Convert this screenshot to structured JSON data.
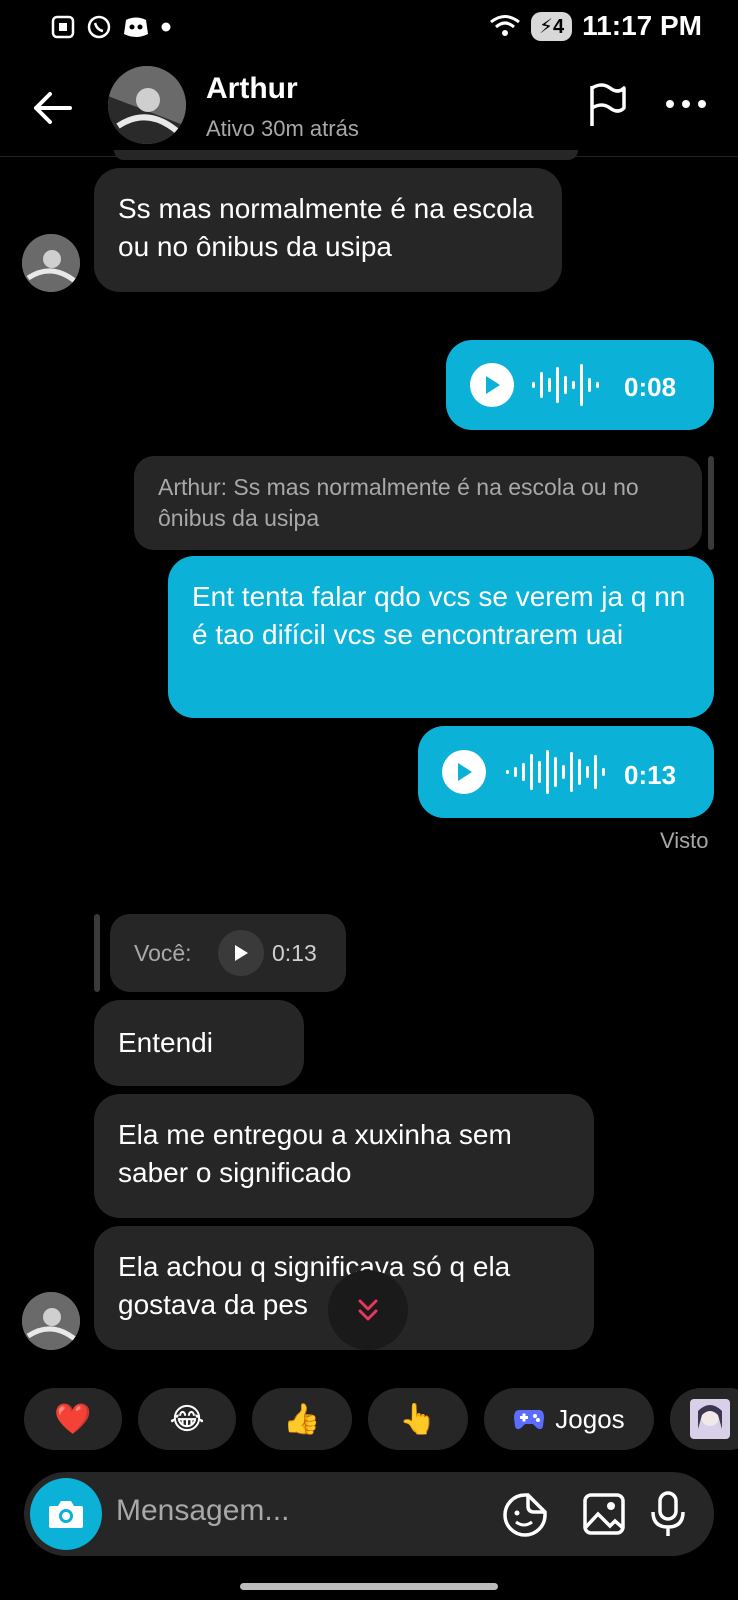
{
  "status_bar": {
    "time": "11:17 PM",
    "battery": "4"
  },
  "header": {
    "name": "Arthur",
    "status": "Ativo 30m atrás"
  },
  "messages": {
    "m1": {
      "text": "Ss mas normalmente é na escola ou no ônibus da usipa"
    },
    "m2": {
      "duration": "0:08"
    },
    "m3": {
      "reply_quote": "Arthur: Ss mas normalmente é na escola ou no ônibus da usipa",
      "text": "Ent tenta falar qdo vcs se verem ja q nn é tao difícil vcs se encontrarem uai"
    },
    "m4": {
      "duration": "0:13",
      "seen": "Visto"
    },
    "m5": {
      "reply_label": "Você:",
      "reply_duration": "0:13",
      "text": "Entendi"
    },
    "m6": {
      "text": "Ela me entregou a xuxinha sem saber o significado"
    },
    "m7": {
      "text": "Ela achou q significava só q ela gostava da pes"
    }
  },
  "reactions": [
    {
      "icon": "heart-icon",
      "emoji": "❤️"
    },
    {
      "icon": "laugh-icon",
      "emoji": "😂"
    },
    {
      "icon": "thumbs-up-icon",
      "emoji": "👍"
    },
    {
      "icon": "pointing-icon",
      "emoji": "👆"
    },
    {
      "icon": "gamepad-icon",
      "label": "Jogos"
    }
  ],
  "composer": {
    "placeholder": "Mensagem..."
  },
  "colors": {
    "accent": "#0bb1d6",
    "bubble_in": "#262626",
    "background": "#000000"
  }
}
